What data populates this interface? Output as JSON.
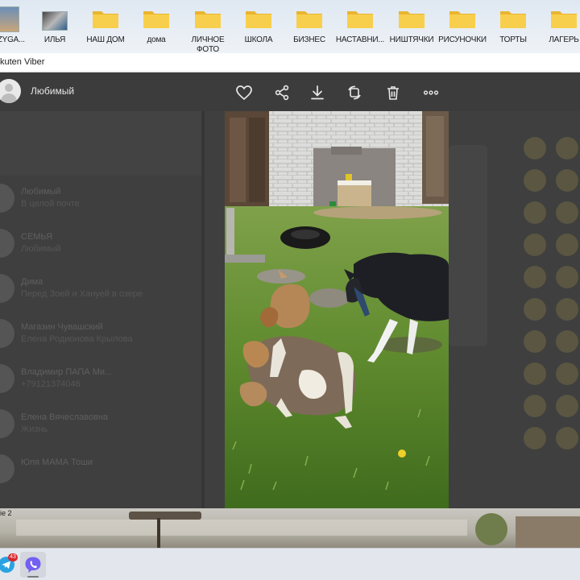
{
  "desktop": {
    "icons": [
      {
        "label": "OZYGA...",
        "kind": "thumb"
      },
      {
        "label": "ИЛЬЯ",
        "kind": "thumb"
      },
      {
        "label": "НАШ ДОМ",
        "kind": "folder"
      },
      {
        "label": "дома",
        "kind": "folder"
      },
      {
        "label": "ЛИЧНОЕ ФОТО",
        "kind": "folder"
      },
      {
        "label": "ШКОЛА",
        "kind": "folder"
      },
      {
        "label": "БИЗНЕС",
        "kind": "folder"
      },
      {
        "label": "НАСТАВНИ...",
        "kind": "folder"
      },
      {
        "label": "НИШТЯЧКИ",
        "kind": "folder"
      },
      {
        "label": "РИСУНОЧКИ",
        "kind": "folder"
      },
      {
        "label": "ТОРТЫ",
        "kind": "folder"
      },
      {
        "label": "ЛАГЕРЬ",
        "kind": "folder"
      }
    ]
  },
  "window": {
    "title": "kuten Viber"
  },
  "viewer": {
    "contact_name": "Любимый",
    "toolbar": [
      "heart-icon",
      "share-icon",
      "download-icon",
      "rotate-icon",
      "trash-icon",
      "more-icon"
    ]
  },
  "background_chats": [
    {
      "name": "Любимый",
      "message": "В целой почте"
    },
    {
      "name": "СЕМЬЯ",
      "message": "Любимый"
    },
    {
      "name": "Дима",
      "message": "Перед Зоей и Хануей в озере"
    },
    {
      "name": "Магазин Чувашский",
      "message": "Елена Родионова Крылова"
    },
    {
      "name": "Владимир ПАПА Ми...",
      "message": "+79121374046"
    },
    {
      "name": "Елена Вячеславовна",
      "message": "Жизнь"
    },
    {
      "name": "Юля МАМА Тоши",
      "message": ""
    }
  ],
  "wallpaper": {
    "corner_text": "ie 2"
  },
  "taskbar": {
    "apps": [
      {
        "name": "telegram-icon",
        "badge": "43",
        "color": "#2aa3e0"
      },
      {
        "name": "viber-icon",
        "badge": "",
        "color": "#7360f2"
      }
    ]
  },
  "colors": {
    "viewer_bg": "#3c3c3c",
    "accent": "#7360f2",
    "folder": "#f5c73d"
  }
}
